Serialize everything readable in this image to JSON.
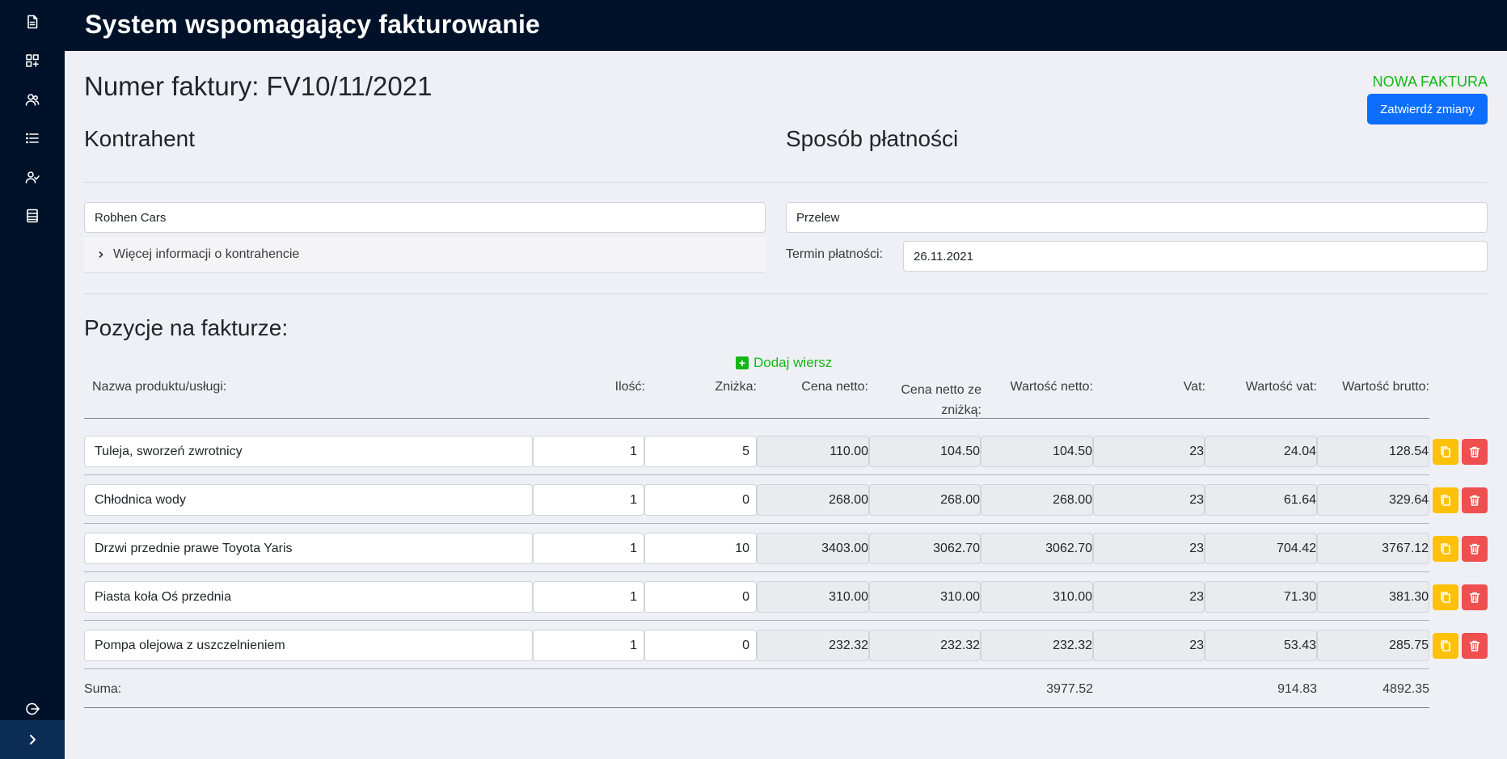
{
  "app": {
    "title": "System wspomagający fakturowanie"
  },
  "sidebar": {
    "icons": [
      "document-icon",
      "dashboard-add-icon",
      "contractors-icon",
      "list-icon",
      "users-icon",
      "ledger-icon"
    ],
    "logout_icon": "logout-icon",
    "expand_icon": "chevron-right-icon"
  },
  "invoice": {
    "title": "Numer faktury: FV10/11/2021",
    "status": "NOWA FAKTURA",
    "confirm_label": "Zatwierdź zmiany"
  },
  "contractor": {
    "heading": "Kontrahent",
    "value": "Robhen Cars",
    "more_info": "Więcej informacji o kontrahencie"
  },
  "payment": {
    "heading": "Sposób płatności",
    "method": "Przelew",
    "due_label": "Termin płatności:",
    "due_value": "26.11.2021"
  },
  "items": {
    "heading": "Pozycje na fakturze:",
    "add_row_label": "Dodaj wiersz",
    "columns": {
      "name": "Nazwa produktu/usługi:",
      "qty": "Ilość:",
      "discount": "Zniżka:",
      "net_price": "Cena netto:",
      "net_price_disc_1": "Cena netto ze",
      "net_price_disc_2": "zniżką:",
      "net_value": "Wartość netto:",
      "vat": "Vat:",
      "vat_value": "Wartość vat:",
      "gross_value": "Wartość brutto:"
    },
    "rows": [
      {
        "name": "Tuleja, sworzeń zwrotnicy",
        "qty": "1",
        "discount": "5",
        "net_price": "110.00",
        "net_price_disc": "104.50",
        "net_value": "104.50",
        "vat": "23",
        "vat_value": "24.04",
        "gross_value": "128.54"
      },
      {
        "name": "Chłodnica wody",
        "qty": "1",
        "discount": "0",
        "net_price": "268.00",
        "net_price_disc": "268.00",
        "net_value": "268.00",
        "vat": "23",
        "vat_value": "61.64",
        "gross_value": "329.64"
      },
      {
        "name": "Drzwi przednie prawe Toyota Yaris",
        "qty": "1",
        "discount": "10",
        "net_price": "3403.00",
        "net_price_disc": "3062.70",
        "net_value": "3062.70",
        "vat": "23",
        "vat_value": "704.42",
        "gross_value": "3767.12"
      },
      {
        "name": "Piasta koła Oś przednia",
        "qty": "1",
        "discount": "0",
        "net_price": "310.00",
        "net_price_disc": "310.00",
        "net_value": "310.00",
        "vat": "23",
        "vat_value": "71.30",
        "gross_value": "381.30"
      },
      {
        "name": "Pompa olejowa z uszczelnieniem",
        "qty": "1",
        "discount": "0",
        "net_price": "232.32",
        "net_price_disc": "232.32",
        "net_value": "232.32",
        "vat": "23",
        "vat_value": "53.43",
        "gross_value": "285.75"
      }
    ],
    "sum": {
      "label": "Suma:",
      "net_value": "3977.52",
      "vat_value": "914.83",
      "gross_value": "4892.35"
    }
  },
  "colors": {
    "sidebar": "#001229",
    "accent": "#0d6efd",
    "success": "#14b814",
    "copy": "#ffc107",
    "delete": "#ef4f4f"
  }
}
